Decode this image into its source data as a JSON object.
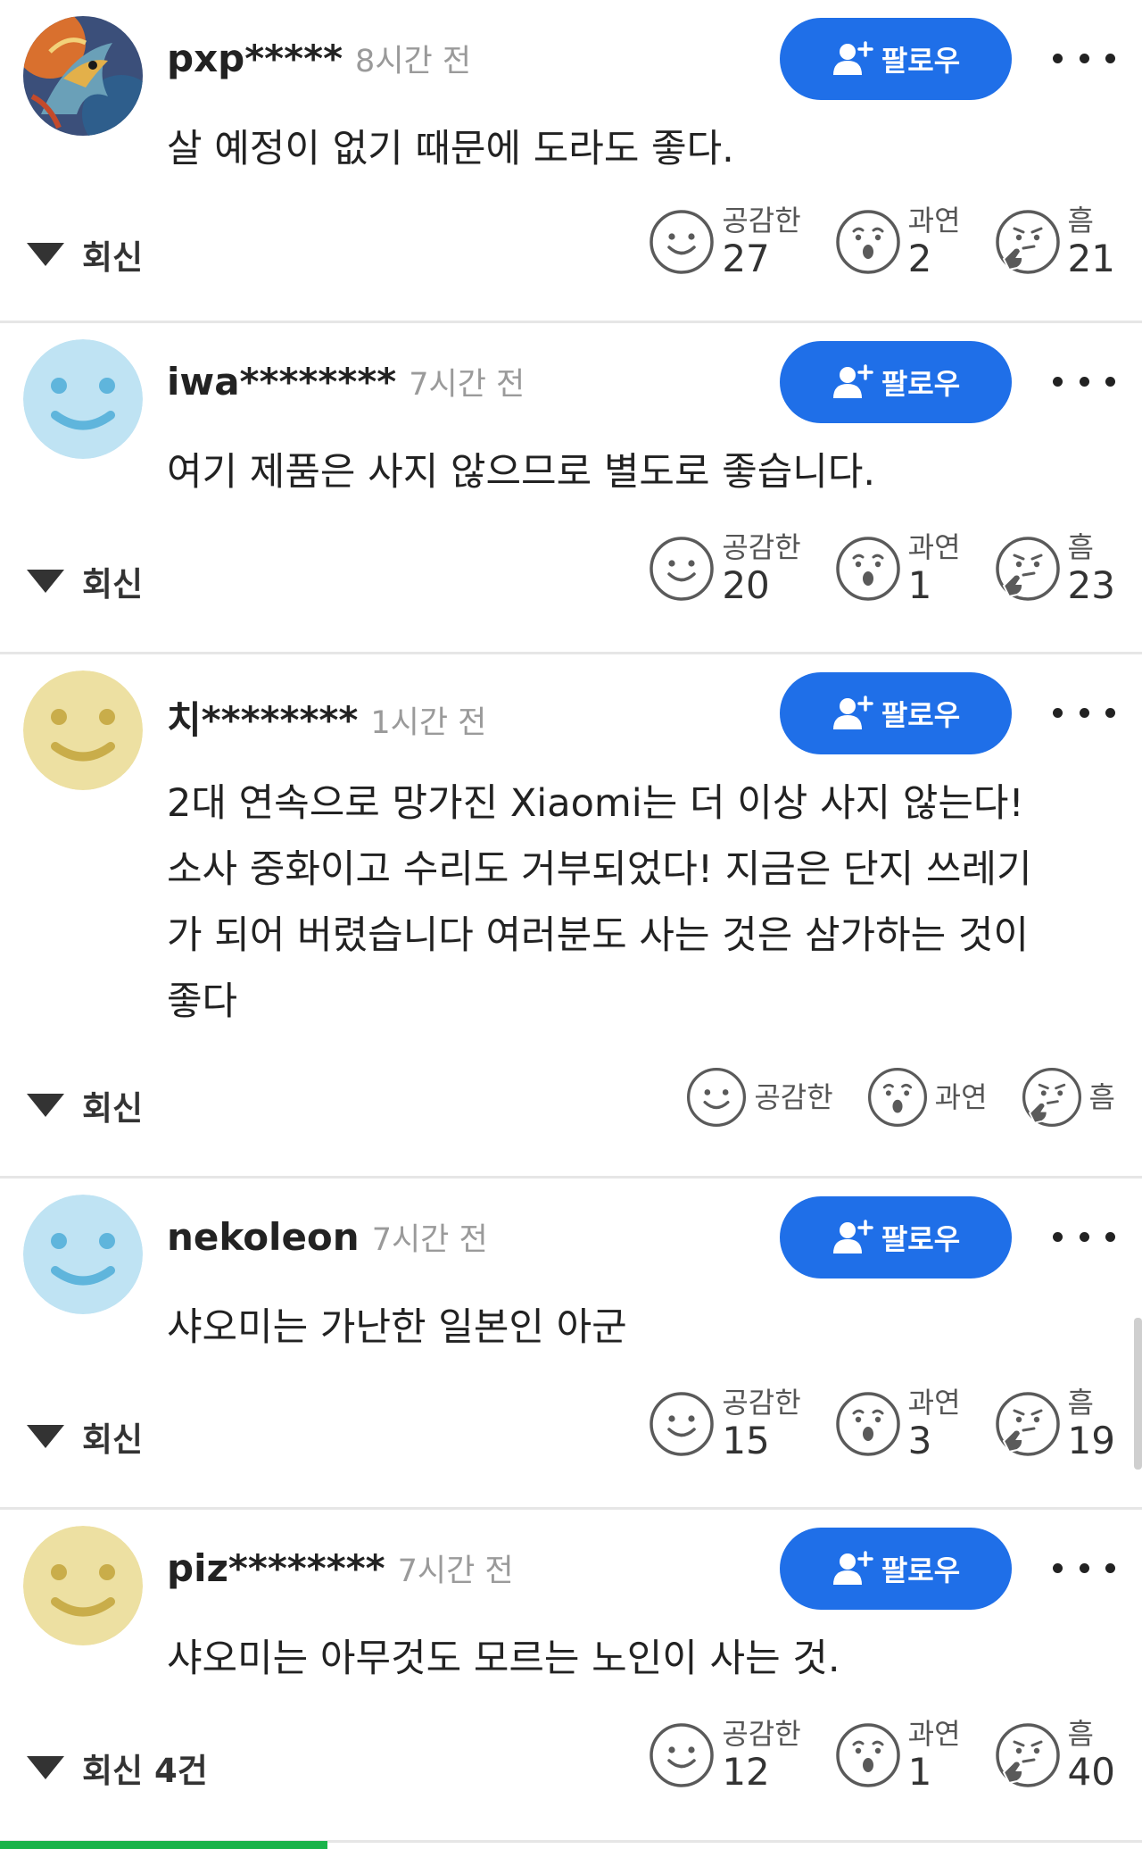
{
  "comments": [
    {
      "username": "pxp*****",
      "time": "8시간 전",
      "follow_label": "팔로우",
      "avatar": "dragon-avatar",
      "lines": [
        "살 예정이 없기 때문에 도라도 좋다."
      ],
      "reply_label": "회신",
      "reactions": {
        "empathy": {
          "label": "공감한",
          "count": "27"
        },
        "surprise": {
          "label": "과연",
          "count": "2"
        },
        "hmm": {
          "label": "흠",
          "count": "21"
        }
      }
    },
    {
      "username": "iwa********",
      "time": "7시간 전",
      "follow_label": "팔로우",
      "avatar": "blue-smiley-avatar",
      "lines": [
        "여기 제품은 사지 않으므로 별도로 좋습니다."
      ],
      "reply_label": "회신",
      "reactions": {
        "empathy": {
          "label": "공감한",
          "count": "20"
        },
        "surprise": {
          "label": "과연",
          "count": "1"
        },
        "hmm": {
          "label": "흠",
          "count": "23"
        }
      }
    },
    {
      "username": "치********",
      "time": "1시간 전",
      "follow_label": "팔로우",
      "avatar": "yellow-smiley-avatar",
      "lines": [
        "2대 연속으로 망가진 Xiaomi는 더 이상 사지 않는다!",
        "소사 중화이고 수리도 거부되었다! 지금은 단지 쓰레기",
        "가 되어 버렸습니다 여러분도 사는 것은 삼가하는 것이",
        "좋다"
      ],
      "reply_label": "회신",
      "reactions": {
        "empathy": {
          "label": "공감한"
        },
        "surprise": {
          "label": "과연"
        },
        "hmm": {
          "label": "흠"
        }
      }
    },
    {
      "username": "nekoleon",
      "time": "7시간 전",
      "follow_label": "팔로우",
      "avatar": "blue-smiley-avatar",
      "lines": [
        "샤오미는 가난한 일본인 아군"
      ],
      "reply_label": "회신",
      "reactions": {
        "empathy": {
          "label": "공감한",
          "count": "15"
        },
        "surprise": {
          "label": "과연",
          "count": "3"
        },
        "hmm": {
          "label": "흠",
          "count": "19"
        }
      }
    },
    {
      "username": "piz********",
      "time": "7시간 전",
      "follow_label": "팔로우",
      "avatar": "yellow-smiley-avatar",
      "lines": [
        "샤오미는 아무것도 모르는 노인이 사는 것."
      ],
      "reply_label": "회신 4건",
      "reactions": {
        "empathy": {
          "label": "공감한",
          "count": "12"
        },
        "surprise": {
          "label": "과연",
          "count": "1"
        },
        "hmm": {
          "label": "흠",
          "count": "40"
        }
      }
    }
  ],
  "colors": {
    "follow_button": "#1f6fe8",
    "blue_avatar": "#bfe3f3",
    "yellow_avatar": "#ede0a2",
    "progress": "#19b34a"
  }
}
